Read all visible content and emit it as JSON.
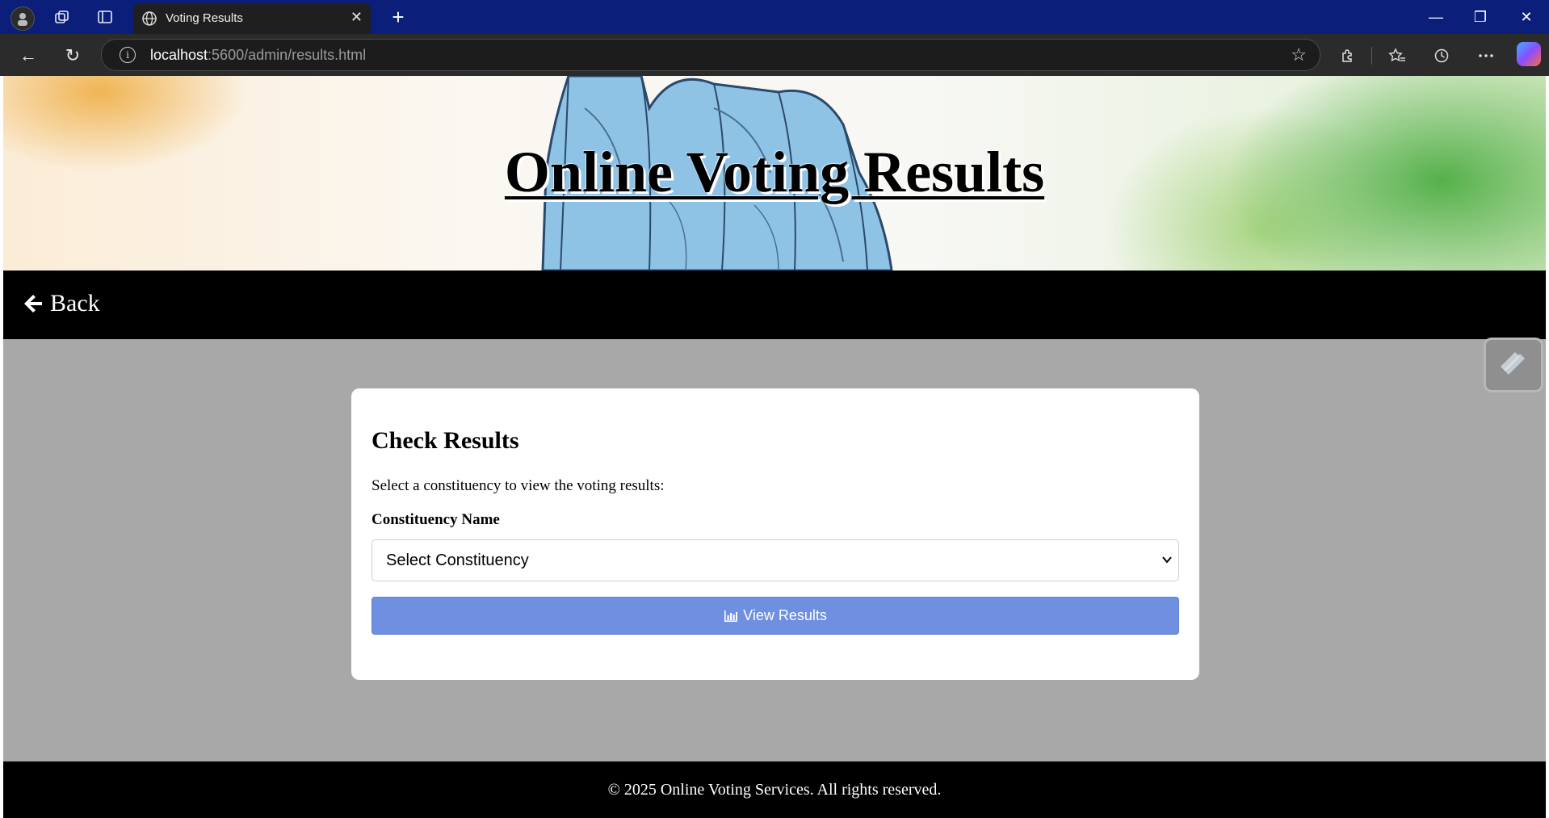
{
  "browser": {
    "tab": {
      "title": "Voting Results",
      "close_glyph": "✕"
    },
    "new_tab_glyph": "+",
    "address": {
      "host": "localhost",
      "rest": ":5600/admin/results.html"
    },
    "window_controls": {
      "minimize": "—",
      "restore": "❐",
      "close": "✕"
    },
    "nav": {
      "back": "←",
      "reload": "↻"
    },
    "toolbar_icons": [
      "extensions-icon",
      "favorites-icon",
      "history-icon",
      "more-icon",
      "copilot-icon"
    ]
  },
  "header": {
    "title": "Online Voting Results"
  },
  "nav": {
    "back_label": "Back"
  },
  "card": {
    "title": "Check Results",
    "description": "Select a constituency to view the voting results:",
    "field_label": "Constituency Name",
    "select": {
      "selected": "Select Constituency"
    },
    "button_label": "View Results"
  },
  "footer": {
    "text": "© 2025 Online Voting Services. All rights reserved."
  },
  "colors": {
    "titlebar": "#0b1f7a",
    "navbar": "#000000",
    "page_bg": "#a8a8a8",
    "button": "#6f8fe0"
  }
}
